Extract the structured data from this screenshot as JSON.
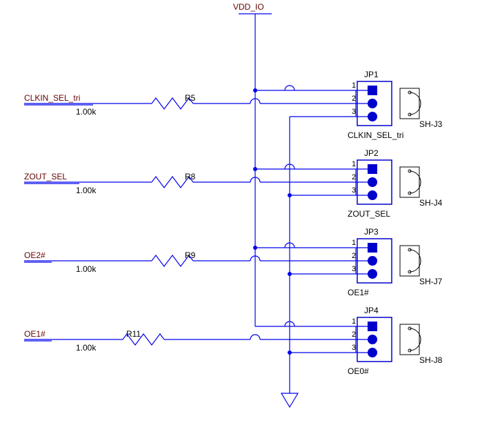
{
  "power": {
    "vdd": "VDD_IO"
  },
  "nets": {
    "n0": "CLKIN_SEL_tri",
    "n1": "ZOUT_SEL",
    "n2": "OE2#",
    "n3": "OE1#"
  },
  "resistors": {
    "r0": {
      "ref": "R5",
      "value": "1.00k"
    },
    "r1": {
      "ref": "R8",
      "value": "1.00k"
    },
    "r2": {
      "ref": "R9",
      "value": "1.00k"
    },
    "r3": {
      "ref": "R11",
      "value": "1.00k"
    }
  },
  "jumpers": {
    "j0": {
      "ref": "JP1",
      "name": "CLKIN_SEL_tri",
      "shunt": "SH-J3",
      "pins": {
        "p1": "1",
        "p2": "2",
        "p3": "3"
      }
    },
    "j1": {
      "ref": "JP2",
      "name": "ZOUT_SEL",
      "shunt": "SH-J4",
      "pins": {
        "p1": "1",
        "p2": "2",
        "p3": "3"
      }
    },
    "j2": {
      "ref": "JP3",
      "name": "OE1#",
      "shunt": "SH-J7",
      "pins": {
        "p1": "1",
        "p2": "2",
        "p3": "3"
      }
    },
    "j3": {
      "ref": "JP4",
      "name": "OE0#",
      "shunt": "SH-J8",
      "pins": {
        "p1": "1",
        "p2": "2",
        "p3": "3"
      }
    }
  }
}
